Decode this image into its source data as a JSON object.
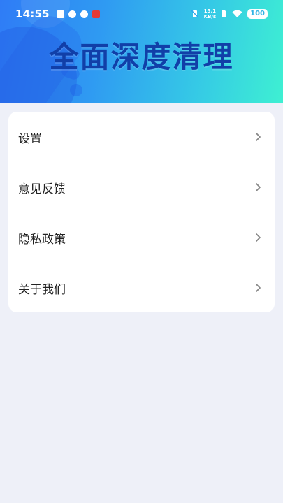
{
  "status_bar": {
    "time": "14:55",
    "net_speed_value": "13.1",
    "net_speed_unit": "KB/s",
    "battery": "100"
  },
  "header": {
    "title": "全面深度清理"
  },
  "menu": {
    "items": [
      {
        "label": "设置"
      },
      {
        "label": "意见反馈"
      },
      {
        "label": "隐私政策"
      },
      {
        "label": "关于我们"
      }
    ]
  },
  "colors": {
    "header_gradient_start": "#2f7cf6",
    "header_gradient_end": "#3ef0d2",
    "title": "#113fa8",
    "page_background": "#eef0f8"
  }
}
